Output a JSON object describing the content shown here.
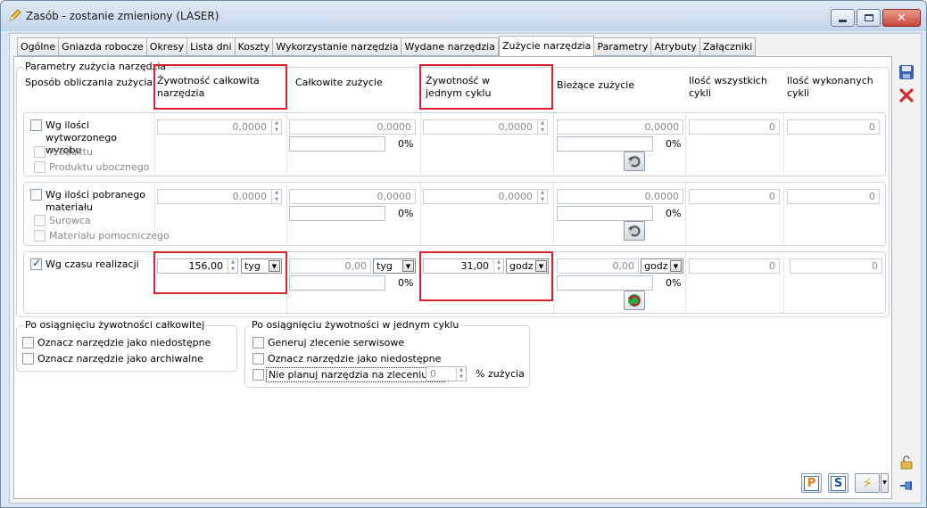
{
  "window": {
    "title": "Zasób - zostanie zmieniony  (LASER)"
  },
  "tabs": [
    "Ogólne",
    "Gniazda robocze",
    "Okresy",
    "Lista dni",
    "Koszty",
    "Wykorzystanie narzędzia",
    "Wydane narzędzia",
    "Zużycie narzędzia",
    "Parametry",
    "Atrybuty",
    "Załączniki"
  ],
  "active_tab": "Zużycie narzędzia",
  "params": {
    "group_title": "Parametry zużycia narzędzia",
    "headers": {
      "method": "Sposób obliczania zużycia",
      "total_life": "Żywotność całkowita narzędzia",
      "total_use": "Całkowite zużycie",
      "cycle_life": "Żywotność w jednym cyklu",
      "current_use": "Bieżące zużycie",
      "all_cycles": "Ilość wszystkich cykli",
      "done_cycles": "Ilość wykonanych cykli"
    },
    "rows": [
      {
        "label": "Wg ilości wytworzonego wyrobu",
        "sub": [
          "Produktu",
          "Produktu ubocznego"
        ],
        "total_life": "0,0000",
        "total_use": "0,0000",
        "total_pct": "0%",
        "cycle_life": "0,0000",
        "current_use": "0,0000",
        "current_pct": "0%",
        "all_cycles": "0",
        "done_cycles": "0"
      },
      {
        "label": "Wg ilości pobranego materiału",
        "sub": [
          "Surowca",
          "Materiału pomocniczego"
        ],
        "total_life": "0,0000",
        "total_use": "0,0000",
        "total_pct": "0%",
        "cycle_life": "0,0000",
        "current_use": "0,0000",
        "current_pct": "0%",
        "all_cycles": "0",
        "done_cycles": "0"
      },
      {
        "label": "Wg czasu realizacji",
        "total_life": "156,00",
        "total_life_unit": "tyg",
        "total_use": "0,00",
        "total_use_unit": "tyg",
        "total_pct": "0%",
        "cycle_life": "31,00",
        "cycle_life_unit": "godz",
        "current_use": "0,00",
        "current_use_unit": "godz",
        "current_pct": "0%",
        "all_cycles": "0",
        "done_cycles": "0"
      }
    ]
  },
  "after_total": {
    "title": "Po osiągnięciu żywotności całkowitej",
    "options": [
      "Oznacz narzędzie jako niedostępne",
      "Oznacz narzędzie jako archiwalne"
    ]
  },
  "after_cycle": {
    "title": "Po osiągnięciu żywotności w jednym cyklu",
    "options": [
      "Generuj zlecenie serwisowe",
      "Oznacz narzędzie jako niedostępne",
      "Nie planuj narzędzia na zleceniu od"
    ],
    "value": "0",
    "suffix": "% zużycia"
  },
  "bottom_buttons": [
    "P",
    "S"
  ],
  "colors": {
    "highlight": "#d6232e"
  }
}
